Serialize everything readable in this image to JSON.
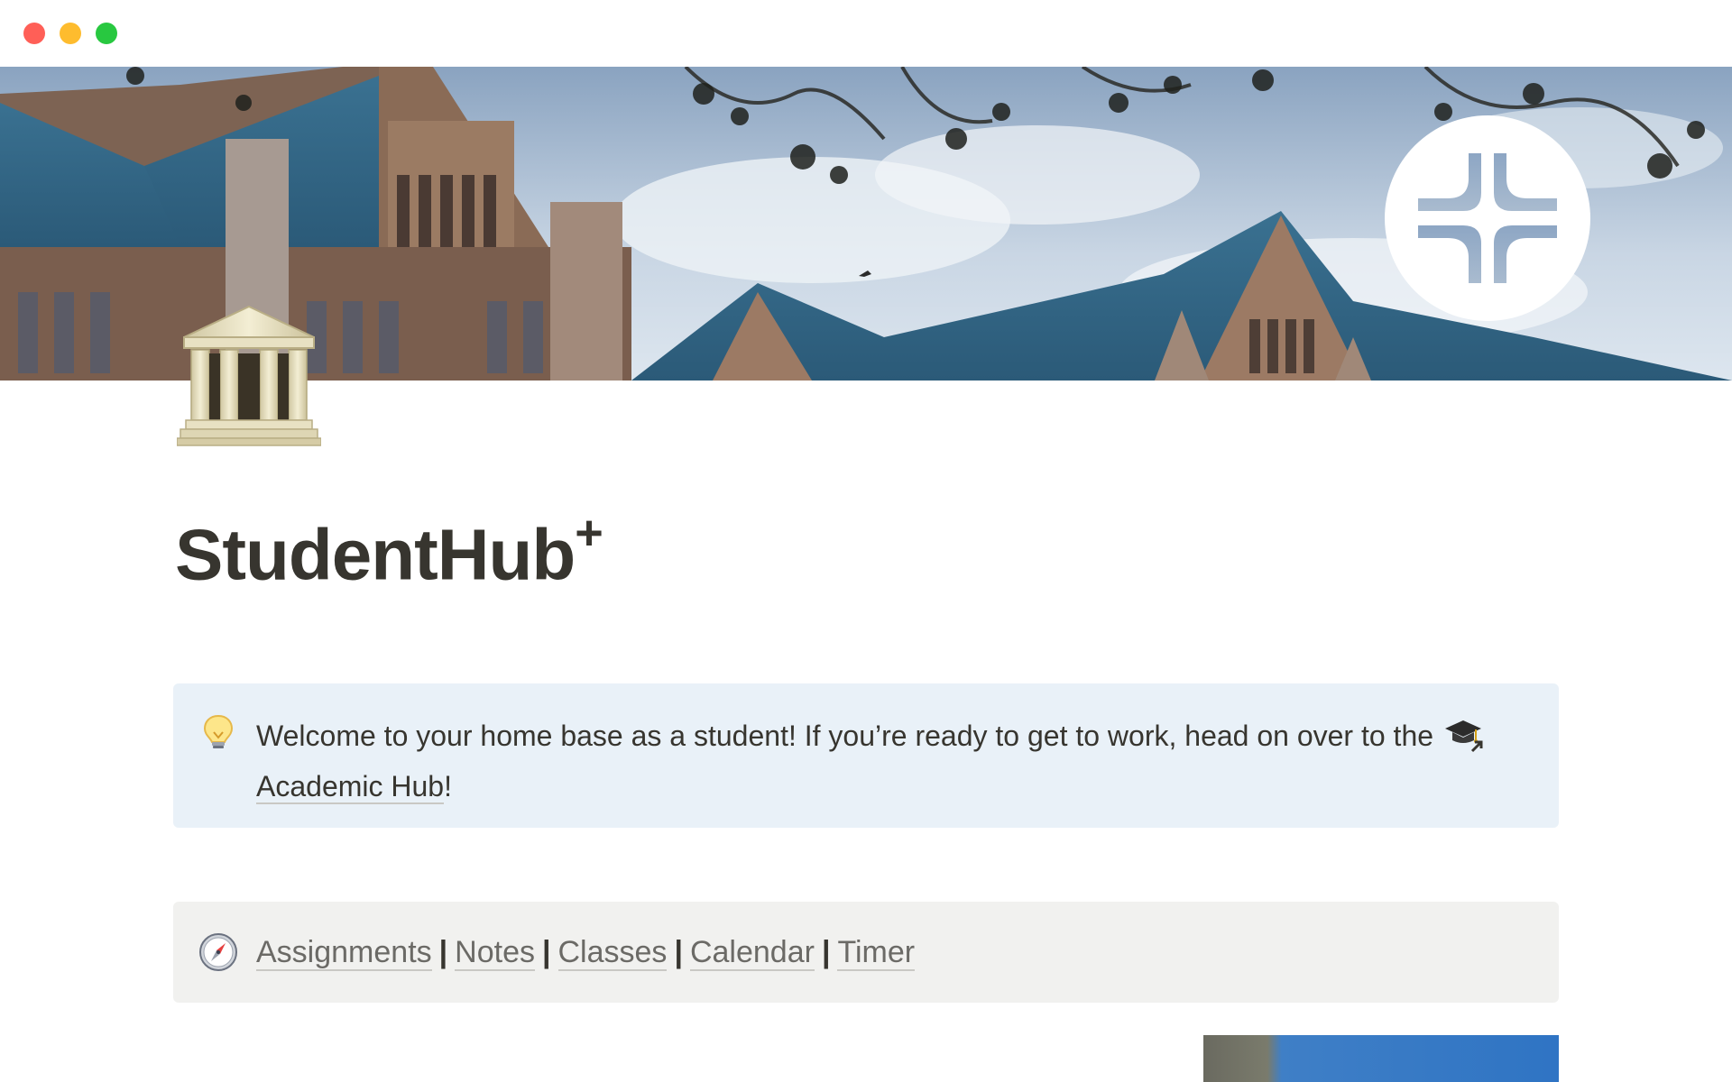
{
  "window": {
    "controls": [
      "close",
      "minimize",
      "maximize"
    ]
  },
  "cover": {
    "icon": "campus-building-photo",
    "badge_icon": "notion-style-plus-logo-icon"
  },
  "page": {
    "icon": "classical-building-icon",
    "title": "StudentHub",
    "title_suffix": "+"
  },
  "welcome_callout": {
    "icon": "light-bulb-icon",
    "text": "Welcome to your home base as a student! If you’re ready to get to work, head on over to the",
    "link_icon": "graduation-cap-icon",
    "link_label": "Academic Hub",
    "trailing": "!"
  },
  "nav_callout": {
    "icon": "compass-icon",
    "links": [
      "Assignments",
      "Notes",
      "Classes",
      "Calendar",
      "Timer"
    ],
    "separator": "|"
  },
  "colors": {
    "welcome_bg": "#e9f1f8",
    "nav_bg": "#f1f1ef",
    "text": "#37352f"
  }
}
